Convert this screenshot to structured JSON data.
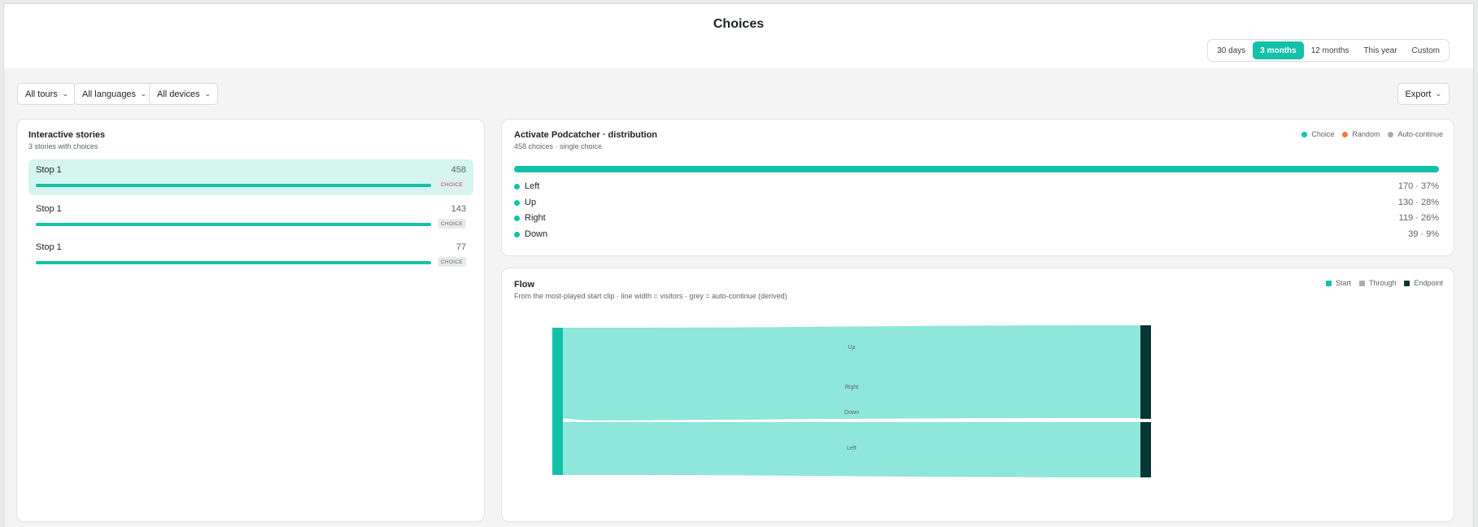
{
  "header": {
    "title": "Choices",
    "ranges": [
      {
        "label": "30 days",
        "active": false
      },
      {
        "label": "3 months",
        "active": true
      },
      {
        "label": "12 months",
        "active": false
      },
      {
        "label": "This year",
        "active": false
      },
      {
        "label": "Custom",
        "active": false
      }
    ]
  },
  "filters": {
    "tours": "All tours",
    "languages": "All languages",
    "devices": "All devices",
    "export": "Export"
  },
  "stories": {
    "title": "Interactive stories",
    "subtitle": "3 stories with choices",
    "items": [
      {
        "name": "Stop 1",
        "count": "458",
        "badge": "CHOICE",
        "selected": true
      },
      {
        "name": "Stop 1",
        "count": "143",
        "badge": "CHOICE",
        "selected": false
      },
      {
        "name": "Stop 1",
        "count": "77",
        "badge": "CHOICE",
        "selected": false
      }
    ]
  },
  "distribution": {
    "title": "Activate Podcatcher · distribution",
    "subtitle": "458 choices · single choice",
    "legend": [
      {
        "label": "Choice",
        "color": "#13c1a8"
      },
      {
        "label": "Random",
        "color": "#f07a3a"
      },
      {
        "label": "Auto-continue",
        "color": "#a9adac"
      }
    ],
    "options": [
      {
        "label": "Left",
        "value": "170 · 37%"
      },
      {
        "label": "Up",
        "value": "130 · 28%"
      },
      {
        "label": "Right",
        "value": "119 · 26%"
      },
      {
        "label": "Down",
        "value": "39 · 9%"
      }
    ]
  },
  "flow": {
    "title": "Flow",
    "subtitle": "From the most-played start clip · line width = visitors · grey = auto-continue (derived)",
    "legend": [
      {
        "label": "Start",
        "color": "#13c1a8"
      },
      {
        "label": "Through",
        "color": "#a9adac"
      },
      {
        "label": "Endpoint",
        "color": "#073634"
      }
    ],
    "labels": {
      "up": "Up",
      "right": "Right",
      "down": "Down",
      "left": "Left"
    },
    "colors": {
      "link": "#8fe6db",
      "start": "#13c1a8",
      "end": "#073634"
    }
  }
}
